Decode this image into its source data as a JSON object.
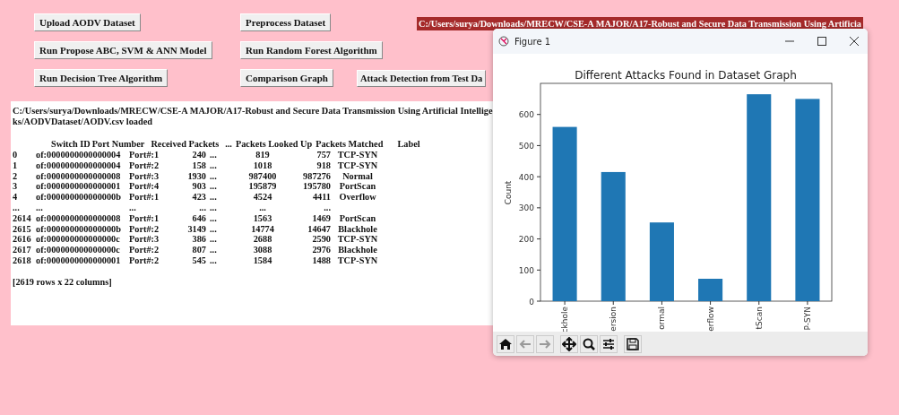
{
  "buttons": [
    {
      "label": "Upload AODV Dataset"
    },
    {
      "label": "Preprocess Dataset"
    },
    {
      "label": "Run Propose ABC, SVM & ANN Model"
    },
    {
      "label": "Run Random Forest Algorithm"
    },
    {
      "label": "Run Decision Tree Algorithm"
    },
    {
      "label": "Comparison Graph"
    },
    {
      "label": "Attack Detection from Test Da"
    }
  ],
  "path_label": "C:/Users/surya/Downloads/MRECW/CSE-A MAJOR/A17-Robust and Secure Data Transmission Using Artificia",
  "text_area": {
    "lines": [
      "C:/Users/surya/Downloads/MRECW/CSE-A MAJOR/A17-Robust and Secure Data Transmission Using Artificial Intellige",
      "ks/AODVDataset/AODV.csv loaded"
    ],
    "table": {
      "columns": [
        "Switch ID",
        "Port Number",
        "Received Packets",
        "...",
        "Packets Looked Up",
        "Packets Matched",
        "Label"
      ],
      "rows": [
        {
          "index": "0",
          "cells": [
            "of:0000000000000004",
            "Port#:1",
            "240",
            "...",
            "819",
            "757",
            "TCP-SYN"
          ]
        },
        {
          "index": "1",
          "cells": [
            "of:0000000000000004",
            "Port#:2",
            "158",
            "...",
            "1018",
            "918",
            "TCP-SYN"
          ]
        },
        {
          "index": "2",
          "cells": [
            "of:0000000000000008",
            "Port#:3",
            "1930",
            "...",
            "987400",
            "987276",
            "Normal"
          ]
        },
        {
          "index": "3",
          "cells": [
            "of:0000000000000001",
            "Port#:4",
            "903",
            "...",
            "195879",
            "195780",
            "PortScan"
          ]
        },
        {
          "index": "4",
          "cells": [
            "of:000000000000000b",
            "Port#:1",
            "423",
            "...",
            "4524",
            "4411",
            "Overflow"
          ]
        },
        {
          "index": "...",
          "cells": [
            "...",
            "...",
            "...",
            "...",
            "...",
            "..."
          ]
        },
        {
          "index": "2614",
          "cells": [
            "of:0000000000000008",
            "Port#:1",
            "646",
            "...",
            "1563",
            "1469",
            "PortScan"
          ]
        },
        {
          "index": "2615",
          "cells": [
            "of:000000000000000b",
            "Port#:2",
            "3149",
            "...",
            "14774",
            "14647",
            "Blackhole"
          ]
        },
        {
          "index": "2616",
          "cells": [
            "of:000000000000000c",
            "Port#:3",
            "386",
            "...",
            "2688",
            "2590",
            "TCP-SYN"
          ]
        },
        {
          "index": "2617",
          "cells": [
            "of:000000000000000c",
            "Port#:2",
            "807",
            "...",
            "3088",
            "2976",
            "Blackhole"
          ]
        },
        {
          "index": "2618",
          "cells": [
            "of:0000000000000001",
            "Port#:2",
            "545",
            "...",
            "1584",
            "1488",
            "TCP-SYN"
          ]
        }
      ]
    },
    "footer": "[2619 rows x 22 columns]"
  },
  "figure": {
    "title": "Figure 1",
    "chart_data": {
      "type": "bar",
      "title": "Different Attacks Found in Dataset Graph",
      "ylabel": "Count",
      "categories": [
        "ckhole",
        "ersion",
        "ormal",
        "erflow",
        "tScan",
        "P-SYN"
      ],
      "values": [
        560,
        415,
        253,
        72,
        665,
        650
      ],
      "ylim": [
        0,
        700
      ],
      "yticks": [
        0,
        100,
        200,
        300,
        400,
        500,
        600
      ]
    }
  }
}
